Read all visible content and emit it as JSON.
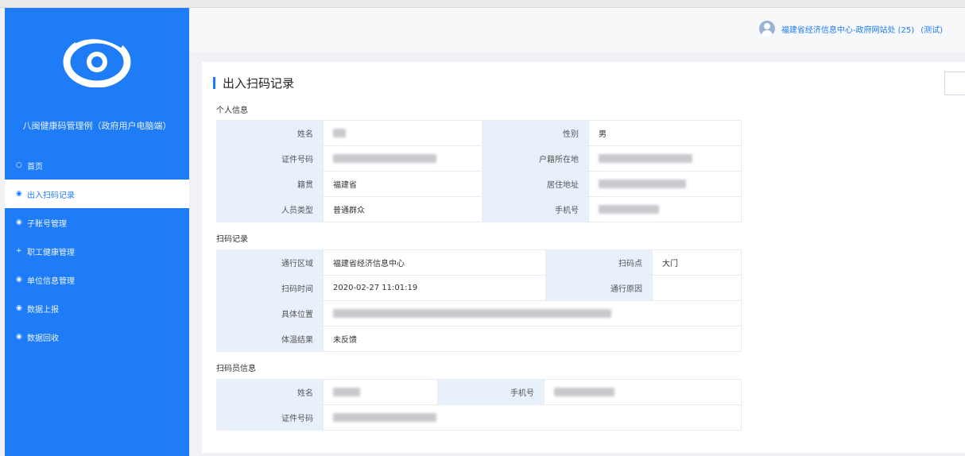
{
  "app_title": "八闽健康码管理例（政府用户电脑端）",
  "menu": [
    {
      "label": "首页",
      "icon": "○",
      "active": false
    },
    {
      "label": "出入扫码记录",
      "icon": "◉",
      "active": true
    },
    {
      "label": "子账号管理",
      "icon": "◉",
      "active": false
    },
    {
      "label": "职工健康管理",
      "icon": "+",
      "active": false
    },
    {
      "label": "单位信息管理",
      "icon": "◉",
      "active": false
    },
    {
      "label": "数据上报",
      "icon": "◉",
      "active": false
    },
    {
      "label": "数据回收",
      "icon": "◉",
      "active": false
    }
  ],
  "header": {
    "user_text": "福建省经济信息中心-政府网站处 (25)",
    "exit_label": "(测试)"
  },
  "page": {
    "title": "出入扫码记录",
    "personal": {
      "section": "个人信息",
      "name_label": "姓名",
      "gender_label": "性别",
      "gender_value": "男",
      "id_label": "证件号码",
      "household_label": "户籍所在地",
      "native_label": "籍贯",
      "native_value": "福建省",
      "address_label": "居住地址",
      "type_label": "人员类型",
      "type_value": "普通群众",
      "phone_label": "手机号"
    },
    "scan": {
      "section": "扫码记录",
      "area_label": "通行区域",
      "area_value": "福建省经济信息中心",
      "point_label": "扫码点",
      "point_value": "大门",
      "time_label": "扫码时间",
      "time_value": "2020-02-27 11:01:19",
      "reason_label": "通行原因",
      "reason_value": "",
      "location_label": "具体位置",
      "temp_label": "体温结果",
      "temp_value": "未反馈"
    },
    "scanner": {
      "section": "扫码员信息",
      "name_label": "姓名",
      "phone_label": "手机号",
      "id_label": "证件号码"
    }
  }
}
